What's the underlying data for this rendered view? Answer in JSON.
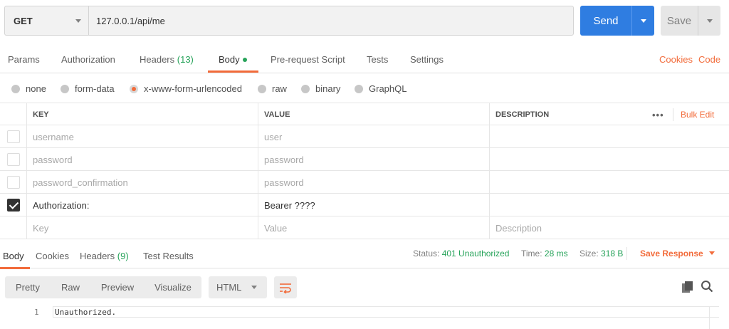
{
  "request": {
    "method": "GET",
    "url": "127.0.0.1/api/me",
    "send_label": "Send",
    "save_label": "Save"
  },
  "request_tabs": {
    "params": "Params",
    "authorization": "Authorization",
    "headers": "Headers",
    "headers_count": "(13)",
    "body": "Body",
    "prerequest": "Pre-request Script",
    "tests": "Tests",
    "settings": "Settings",
    "cookies": "Cookies",
    "code": "Code",
    "active": "Body"
  },
  "body_types": {
    "none": "none",
    "form_data": "form-data",
    "urlencoded": "x-www-form-urlencoded",
    "raw": "raw",
    "binary": "binary",
    "graphql": "GraphQL",
    "selected": "x-www-form-urlencoded"
  },
  "params_table": {
    "headers": {
      "key": "KEY",
      "value": "VALUE",
      "description": "DESCRIPTION",
      "more": "•••",
      "bulk_edit": "Bulk Edit"
    },
    "rows": [
      {
        "key": "username",
        "value": "user",
        "description": "",
        "checked": false
      },
      {
        "key": "password",
        "value": "password",
        "description": "",
        "checked": false
      },
      {
        "key": "password_confirmation",
        "value": "password",
        "description": "",
        "checked": false
      },
      {
        "key": "Authorization:",
        "value": "Bearer ????",
        "description": "",
        "checked": true
      }
    ],
    "placeholder": {
      "key": "Key",
      "value": "Value",
      "description": "Description"
    }
  },
  "response_tabs": {
    "body": "Body",
    "cookies": "Cookies",
    "headers": "Headers",
    "headers_count": "(9)",
    "test_results": "Test Results",
    "active": "Body"
  },
  "response_meta": {
    "status_label": "Status:",
    "status_value": "401 Unauthorized",
    "time_label": "Time:",
    "time_value": "28 ms",
    "size_label": "Size:",
    "size_value": "318 B",
    "save_response": "Save Response"
  },
  "viewer": {
    "pretty": "Pretty",
    "raw": "Raw",
    "preview": "Preview",
    "visualize": "Visualize",
    "format": "HTML",
    "active": "Pretty"
  },
  "response_body": {
    "lines": [
      {
        "number": "1",
        "text": "Unauthorized."
      }
    ]
  },
  "colors": {
    "accent": "#f26b3a",
    "send": "#2f7de1",
    "success": "#27a35a"
  },
  "icons": {
    "method_dropdown": "chevron-down-icon",
    "send_dropdown": "chevron-down-icon",
    "save_dropdown": "chevron-down-icon",
    "wrap": "wrap-lines-icon",
    "copy": "copy-icon",
    "search": "search-icon"
  }
}
